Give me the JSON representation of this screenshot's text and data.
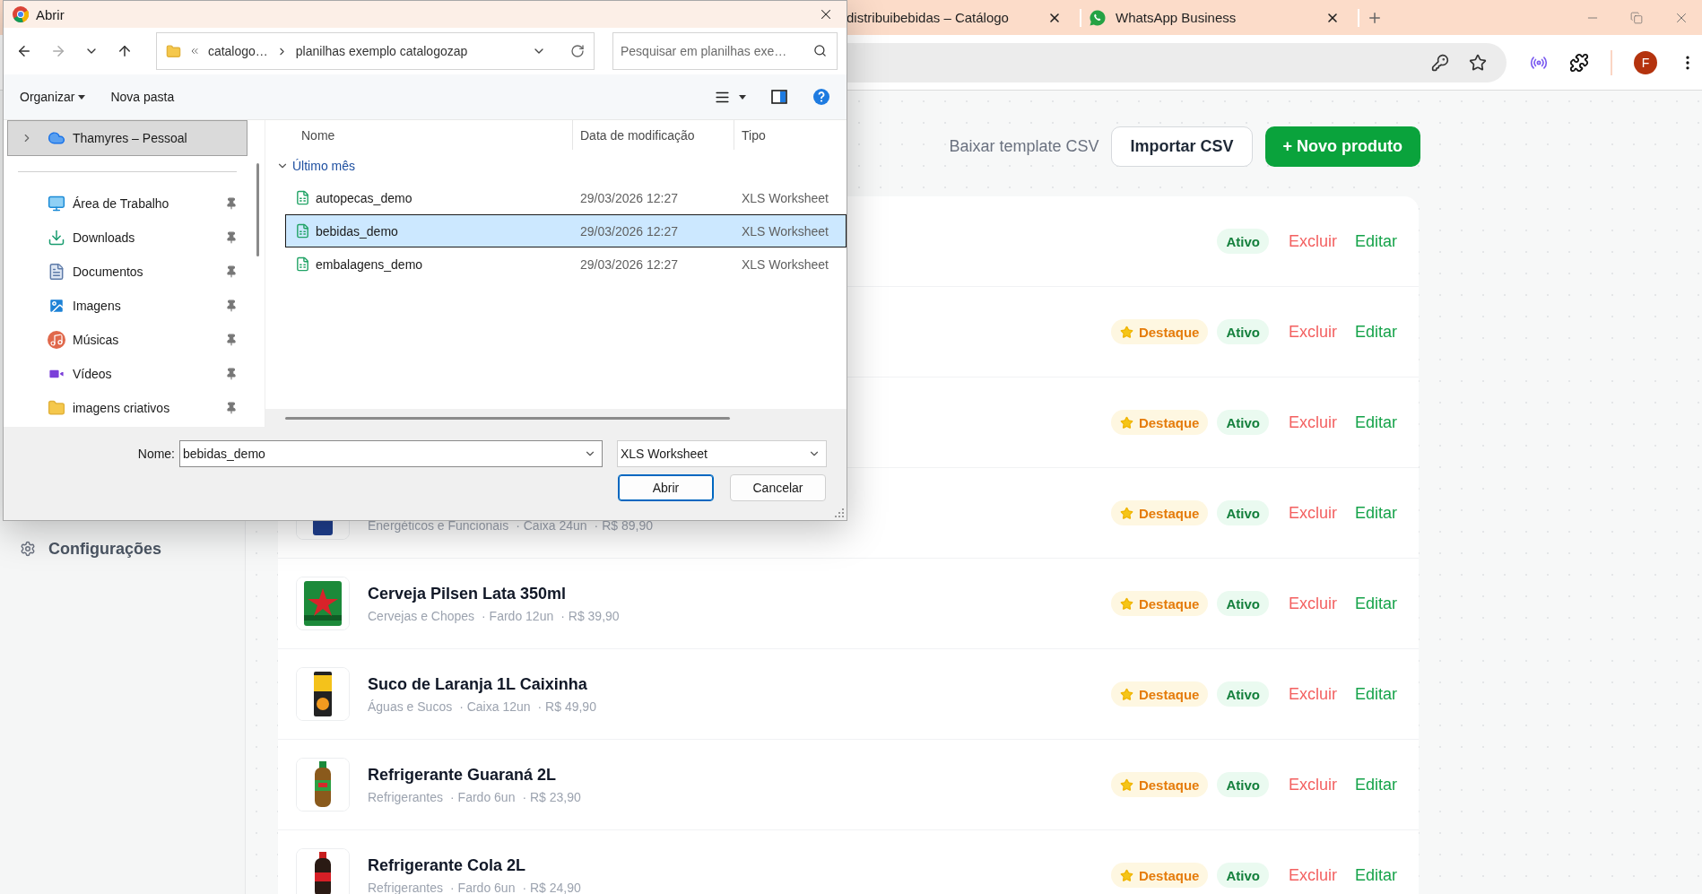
{
  "browser": {
    "tabs": [
      {
        "title": "distribuibebidas – Catálogo"
      },
      {
        "title": "WhatsApp Business"
      }
    ],
    "avatar": "F"
  },
  "dialog": {
    "title": "Abrir",
    "breadcrumb": [
      "catalogo…",
      "planilhas exemplo catalogozap"
    ],
    "search": {
      "placeholder": "Pesquisar em planilhas exe…"
    },
    "toolbar": [
      {
        "label": "Organizar",
        "menu": true
      },
      {
        "label": "Nova pasta",
        "menu": false
      }
    ],
    "nav_items": [
      {
        "label": "Thamyres – Pessoal",
        "selected": true,
        "pinned": false
      },
      {
        "label": "Área de Trabalho",
        "selected": false,
        "pinned": true
      },
      {
        "label": "Downloads",
        "selected": false,
        "pinned": true
      },
      {
        "label": "Documentos",
        "selected": false,
        "pinned": true
      },
      {
        "label": "Imagens",
        "selected": false,
        "pinned": true
      },
      {
        "label": "Músicas",
        "selected": false,
        "pinned": true
      },
      {
        "label": "Vídeos",
        "selected": false,
        "pinned": true
      },
      {
        "label": "imagens criativos",
        "selected": false,
        "pinned": true
      }
    ],
    "columns": [
      "Nome",
      "Data de modificação",
      "Tipo"
    ],
    "group": {
      "label": "Último mês",
      "expanded": true
    },
    "files": [
      {
        "name": "autopecas_demo",
        "date": "29/03/2026 12:27",
        "type": "XLS Worksheet",
        "selected": false
      },
      {
        "name": "bebidas_demo",
        "date": "29/03/2026 12:27",
        "type": "XLS Worksheet",
        "selected": true
      },
      {
        "name": "embalagens_demo",
        "date": "29/03/2026 12:27",
        "type": "XLS Worksheet",
        "selected": false
      }
    ],
    "name_label": "Nome:",
    "name_value": "bebidas_demo",
    "file_type": "XLS Worksheet",
    "buttons": [
      {
        "label": "Abrir",
        "default": true
      },
      {
        "label": "Cancelar",
        "default": false
      }
    ]
  },
  "sidebar": {
    "items": [
      {
        "label": "Configurações"
      }
    ]
  },
  "header_actions": [
    {
      "label": "Baixar template CSV",
      "kind": "link"
    },
    {
      "label": "Importar CSV",
      "kind": "secondary"
    },
    {
      "label": "+ Novo produto",
      "kind": "primary"
    }
  ],
  "products": [
    {
      "featured": false,
      "status": "Ativo",
      "actions": [
        "Excluir",
        "Editar"
      ]
    },
    {
      "featured": true,
      "badge": "Destaque",
      "status": "Ativo",
      "actions": [
        "Excluir",
        "Editar"
      ]
    },
    {
      "featured": true,
      "badge": "Destaque",
      "status": "Ativo",
      "actions": [
        "Excluir",
        "Editar"
      ]
    },
    {
      "image": {
        "kind": "picture"
      },
      "meta": [
        "Energéticos e Funcionais",
        "· Caixa 24un",
        "· R$ 89,90"
      ],
      "featured": true,
      "badge": "Destaque",
      "status": "Ativo",
      "actions": [
        "Excluir",
        "Editar"
      ]
    },
    {
      "image": {
        "kind": "picture"
      },
      "name": "Cerveja Pilsen Lata 350ml",
      "meta": [
        "Cervejas e Chopes",
        "· Fardo 12un",
        "· R$ 39,90"
      ],
      "featured": true,
      "badge": "Destaque",
      "status": "Ativo",
      "actions": [
        "Excluir",
        "Editar"
      ]
    },
    {
      "image": {
        "kind": "picture"
      },
      "name": "Suco de Laranja 1L Caixinha",
      "meta": [
        "Águas e Sucos",
        "· Caixa 12un",
        "· R$ 49,90"
      ],
      "featured": true,
      "badge": "Destaque",
      "status": "Ativo",
      "actions": [
        "Excluir",
        "Editar"
      ]
    },
    {
      "image": {
        "kind": "picture"
      },
      "name": "Refrigerante Guaraná 2L",
      "meta": [
        "Refrigerantes",
        "· Fardo 6un",
        "· R$ 23,90"
      ],
      "featured": true,
      "badge": "Destaque",
      "status": "Ativo",
      "actions": [
        "Excluir",
        "Editar"
      ]
    },
    {
      "image": {
        "kind": "picture"
      },
      "name": "Refrigerante Cola 2L",
      "meta": [
        "Refrigerantes",
        "· Fardo 6un",
        "· R$ 24,90"
      ],
      "featured": true,
      "badge": "Destaque",
      "status": "Ativo",
      "actions": [
        "Excluir",
        "Editar"
      ]
    }
  ]
}
